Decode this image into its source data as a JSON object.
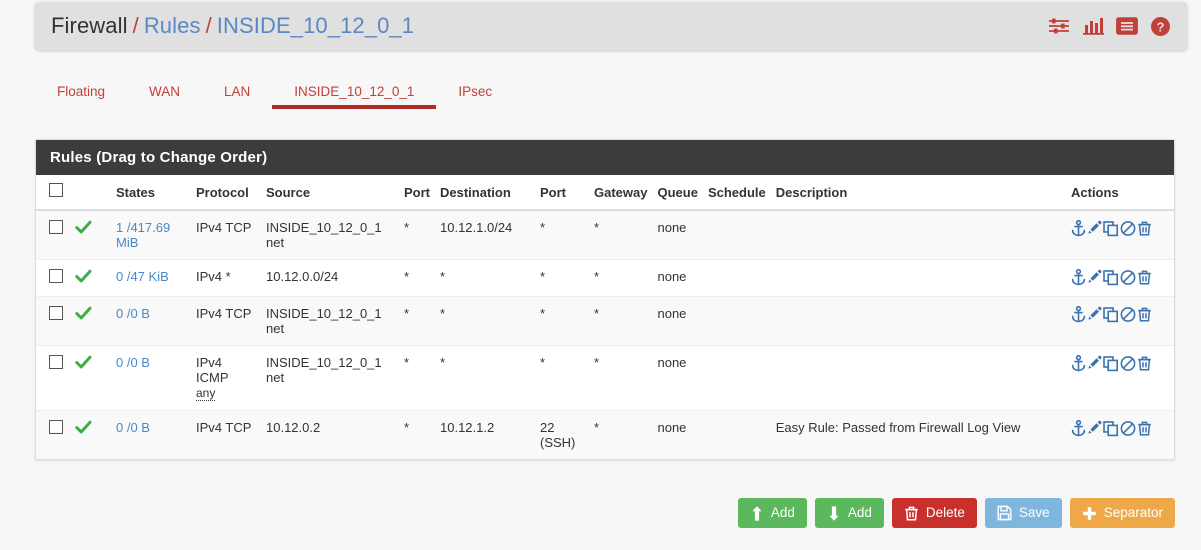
{
  "breadcrumb": {
    "root": "Firewall",
    "sep": "/",
    "section": "Rules",
    "current": "INSIDE_10_12_0_1"
  },
  "header_icons": [
    {
      "name": "sliders-icon",
      "title": "Advanced Filter"
    },
    {
      "name": "bar-chart-icon",
      "title": "Statistics"
    },
    {
      "name": "list-icon",
      "title": "Log"
    },
    {
      "name": "help-circle-icon",
      "title": "Help"
    }
  ],
  "tabs": [
    {
      "label": "Floating",
      "active": false
    },
    {
      "label": "WAN",
      "active": false
    },
    {
      "label": "LAN",
      "active": false
    },
    {
      "label": "INSIDE_10_12_0_1",
      "active": true
    },
    {
      "label": "IPsec",
      "active": false
    }
  ],
  "panel": {
    "title": "Rules (Drag to Change Order)",
    "columns": {
      "select_all": "",
      "states": "States",
      "protocol": "Protocol",
      "source": "Source",
      "source_port": "Port",
      "destination": "Destination",
      "dest_port": "Port",
      "gateway": "Gateway",
      "queue": "Queue",
      "schedule": "Schedule",
      "description": "Description",
      "actions": "Actions"
    },
    "rows": [
      {
        "status": "pass",
        "states": "1 /417.69 MiB",
        "protocol": "IPv4 TCP",
        "protocol_extra": "",
        "source": "INSIDE_10_12_0_1 net",
        "source_port": "*",
        "destination": "10.12.1.0/24",
        "dest_port": "*",
        "gateway": "*",
        "queue": "none",
        "schedule": "",
        "description": ""
      },
      {
        "status": "pass",
        "states": "0 /47 KiB",
        "protocol": "IPv4 *",
        "protocol_extra": "",
        "source": "10.12.0.0/24",
        "source_port": "*",
        "destination": "*",
        "dest_port": "*",
        "gateway": "*",
        "queue": "none",
        "schedule": "",
        "description": ""
      },
      {
        "status": "pass",
        "states": "0 /0 B",
        "protocol": "IPv4 TCP",
        "protocol_extra": "",
        "source": "INSIDE_10_12_0_1 net",
        "source_port": "*",
        "destination": "*",
        "dest_port": "*",
        "gateway": "*",
        "queue": "none",
        "schedule": "",
        "description": ""
      },
      {
        "status": "pass",
        "states": "0 /0 B",
        "protocol": "IPv4 ICMP",
        "protocol_extra": "any",
        "source": "INSIDE_10_12_0_1 net",
        "source_port": "*",
        "destination": "*",
        "dest_port": "*",
        "gateway": "*",
        "queue": "none",
        "schedule": "",
        "description": ""
      },
      {
        "status": "pass",
        "states": "0 /0 B",
        "protocol": "IPv4 TCP",
        "protocol_extra": "",
        "source": "10.12.0.2",
        "source_port": "*",
        "destination": "10.12.1.2",
        "dest_port": "22 (SSH)",
        "gateway": "*",
        "queue": "none",
        "schedule": "",
        "description": "Easy Rule: Passed from Firewall Log View"
      }
    ],
    "row_actions": [
      {
        "name": "anchor-icon",
        "title": "Move"
      },
      {
        "name": "pencil-icon",
        "title": "Edit"
      },
      {
        "name": "copy-icon",
        "title": "Copy"
      },
      {
        "name": "ban-icon",
        "title": "Disable"
      },
      {
        "name": "trash-icon",
        "title": "Delete"
      }
    ]
  },
  "footer_buttons": [
    {
      "label": "Add",
      "icon": "arrow-up-icon",
      "style": "btn-success"
    },
    {
      "label": "Add",
      "icon": "arrow-down-icon",
      "style": "btn-success"
    },
    {
      "label": "Delete",
      "icon": "trash-icon",
      "style": "btn-danger"
    },
    {
      "label": "Save",
      "icon": "floppy-icon",
      "style": "btn-save"
    },
    {
      "label": "Separator",
      "icon": "plus-icon",
      "style": "btn-warning"
    }
  ],
  "colors": {
    "brand_red": "#c2403a",
    "link_blue": "#4a89c8",
    "panel_header": "#3c3c3c",
    "pass_green": "#3eae49",
    "action_blue": "#3b73af"
  }
}
